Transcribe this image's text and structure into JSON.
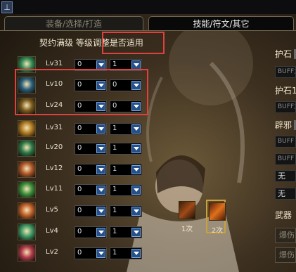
{
  "window": {
    "system_icon": "app-icon"
  },
  "tabs": [
    {
      "label": "装备/选择/打造",
      "active": false
    },
    {
      "label": "技能/符文/其它",
      "active": true
    }
  ],
  "header": {
    "text": "契约满级 等级调整是否适用"
  },
  "skill_rows": [
    {
      "level": "Lv31",
      "val1": "0",
      "val2": "1",
      "icon": "skill-icon-1",
      "color": "#2f8a55"
    },
    {
      "level": "Lv10",
      "val1": "0",
      "val2": "0",
      "icon": "skill-icon-2",
      "color": "#2a5f7a"
    },
    {
      "level": "Lv24",
      "val1": "0",
      "val2": "0",
      "icon": "skill-icon-3",
      "color": "#7a5a1e"
    },
    {
      "level": "Lv31",
      "val1": "0",
      "val2": "1",
      "icon": "skill-icon-4",
      "color": "#b07a22"
    },
    {
      "level": "Lv20",
      "val1": "0",
      "val2": "1",
      "icon": "skill-icon-5",
      "color": "#2e7a4a"
    },
    {
      "level": "Lv12",
      "val1": "0",
      "val2": "1",
      "icon": "skill-icon-6",
      "color": "#b0582a"
    },
    {
      "level": "Lv11",
      "val1": "0",
      "val2": "1",
      "icon": "skill-icon-7",
      "color": "#3d8e3d"
    },
    {
      "level": "Lv5",
      "val1": "0",
      "val2": "1",
      "icon": "skill-icon-8",
      "color": "#c0602a"
    },
    {
      "level": "Lv4",
      "val1": "0",
      "val2": "1",
      "icon": "skill-icon-9",
      "color": "#3f9a66"
    },
    {
      "level": "Lv2",
      "val1": "0",
      "val2": "1",
      "icon": "skill-icon-10",
      "color": "#b03a4a"
    }
  ],
  "right_panel": {
    "label_amulet1": "护石",
    "field1": "BUFF力",
    "label_amulet2": "护石1",
    "field2": "BUFF力",
    "label_evil": "辟邪",
    "field3": "BUFF",
    "field4": "BUFF",
    "field5": "无",
    "field6": "无",
    "label_weapon": "武器",
    "input1": "爆伤",
    "input2": "爆伤"
  },
  "counters": [
    {
      "label": "1次",
      "icon": "counter-icon-1"
    },
    {
      "label": "2次",
      "icon": "counter-icon-2"
    }
  ]
}
